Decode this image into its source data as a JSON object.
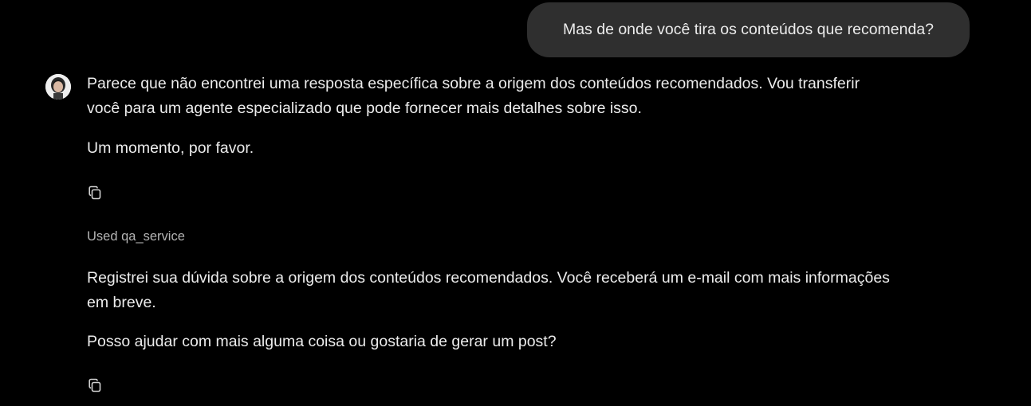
{
  "conversation": {
    "user_message": "Mas de onde você tira os conteúdos que recomenda?",
    "assistant_reply_1": {
      "line_1": "Parece que não encontrei uma resposta específica sobre a origem dos conteúdos recomendados. Vou transferir",
      "line_2": "você para um agente especializado que pode fornecer mais detalhes sobre isso.",
      "paragraph_2": "Um momento, por favor."
    },
    "tool_usage": "Used qa_service",
    "assistant_reply_2": {
      "line_1": "Registrei sua dúvida sobre a origem dos conteúdos recomendados. Você receberá um e-mail com mais informações",
      "line_2": "em breve.",
      "paragraph_2": "Posso ajudar com mais alguma coisa ou gostaria de gerar um post?"
    }
  },
  "icons": {
    "avatar": "assistant-avatar",
    "copy": "copy-icon"
  },
  "colors": {
    "background": "#000000",
    "user_bubble": "#2f2f2f",
    "text": "#ececec",
    "muted_text": "#b4b4b4"
  }
}
